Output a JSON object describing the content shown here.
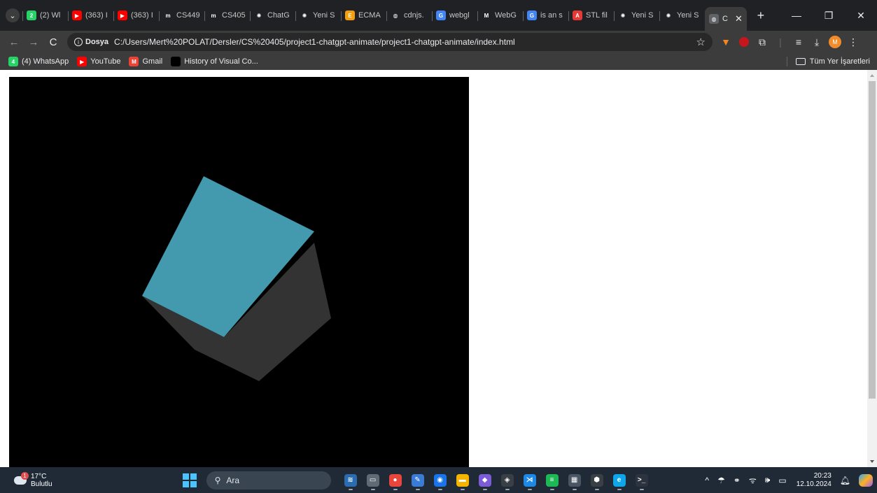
{
  "browser": {
    "tabs": [
      {
        "title": "(2) Wl",
        "icon": "whatsapp-icon",
        "color": "#25d366",
        "glyph": "2"
      },
      {
        "title": "(363) I",
        "icon": "youtube-icon",
        "color": "#ff0000",
        "glyph": "▶"
      },
      {
        "title": "(363) I",
        "icon": "youtube-icon",
        "color": "#ff0000",
        "glyph": "▶"
      },
      {
        "title": "CS449",
        "icon": "moodle-icon",
        "color": "#202124",
        "glyph": "m"
      },
      {
        "title": "CS405",
        "icon": "moodle-icon",
        "color": "#202124",
        "glyph": "m"
      },
      {
        "title": "ChatG",
        "icon": "chatgpt-icon",
        "color": "#202124",
        "glyph": "✺"
      },
      {
        "title": "Yeni S",
        "icon": "chatgpt-icon",
        "color": "#202124",
        "glyph": "✺"
      },
      {
        "title": "ECMA",
        "icon": "ecma-icon",
        "color": "#f59e0b",
        "glyph": "E"
      },
      {
        "title": "cdnjs.",
        "icon": "globe-icon",
        "color": "#202124",
        "glyph": "◍"
      },
      {
        "title": "webgl",
        "icon": "google-icon",
        "color": "#4285f4",
        "glyph": "G"
      },
      {
        "title": "WebG",
        "icon": "mdn-icon",
        "color": "#202124",
        "glyph": "M"
      },
      {
        "title": "is an s",
        "icon": "google-icon",
        "color": "#4285f4",
        "glyph": "G"
      },
      {
        "title": "STL fil",
        "icon": "autodesk-icon",
        "color": "#e53935",
        "glyph": "A"
      },
      {
        "title": "Yeni S",
        "icon": "chatgpt-icon",
        "color": "#202124",
        "glyph": "✺"
      },
      {
        "title": "Yeni S",
        "icon": "chatgpt-icon",
        "color": "#202124",
        "glyph": "✺"
      }
    ],
    "active_tab": {
      "title": "C",
      "icon": "globe-icon"
    },
    "toolbar": {
      "back": "←",
      "forward": "→",
      "reload": "C",
      "site_chip": "Dosya",
      "url": "C:/Users/Mert%20POLAT/Dersler/CS%20405/project1-chatgpt-animate/project1-chatgpt-animate/index.html"
    },
    "bookmarks": [
      {
        "label": "(4) WhatsApp",
        "icon": "whatsapp-icon",
        "color": "#25d366",
        "glyph": "4"
      },
      {
        "label": "YouTube",
        "icon": "youtube-icon",
        "color": "#ff0000",
        "glyph": "▶"
      },
      {
        "label": "Gmail",
        "icon": "gmail-icon",
        "color": "#ea4335",
        "glyph": "M"
      },
      {
        "label": "History of Visual Co...",
        "icon": "black-square-icon",
        "color": "#000000",
        "glyph": ""
      }
    ],
    "all_bookmarks": "Tüm Yer İşaretleri",
    "avatar_letter": "M"
  },
  "scene": {
    "background": "#000000",
    "cube_faces": {
      "top": "#4399ad",
      "side": "#333333"
    }
  },
  "taskbar": {
    "weather": {
      "temp": "17°C",
      "desc": "Bulutlu",
      "badge": "1"
    },
    "search_placeholder": "Ara",
    "apps": [
      {
        "name": "widgets-app",
        "color": "#2b6cb0",
        "glyph": "≋"
      },
      {
        "name": "task-view-app",
        "color": "#606a75",
        "glyph": "▭"
      },
      {
        "name": "chrome-app",
        "color": "#e8453c",
        "glyph": "●"
      },
      {
        "name": "paint-app",
        "color": "#3a7bd5",
        "glyph": "✎"
      },
      {
        "name": "maps-app",
        "color": "#1a73e8",
        "glyph": "◉"
      },
      {
        "name": "file-explorer-app",
        "color": "#f4b400",
        "glyph": "▬"
      },
      {
        "name": "visual-studio-app",
        "color": "#7b5cd6",
        "glyph": "◆"
      },
      {
        "name": "unity-app",
        "color": "#3a3f46",
        "glyph": "◈"
      },
      {
        "name": "vscode-app",
        "color": "#1e88e5",
        "glyph": "⋊"
      },
      {
        "name": "spotify-app",
        "color": "#1db954",
        "glyph": "≡"
      },
      {
        "name": "calculator-app",
        "color": "#4a5563",
        "glyph": "▦"
      },
      {
        "name": "steam-app",
        "color": "#3a3f46",
        "glyph": "⬢"
      },
      {
        "name": "edge-app",
        "color": "#0ea5e9",
        "glyph": "e"
      },
      {
        "name": "terminal-app",
        "color": "#2d3440",
        "glyph": ">_"
      }
    ],
    "tray_icons": [
      "^",
      "☂",
      "⚭",
      "ᯤ",
      "🕪",
      "▭"
    ],
    "time": "20:23",
    "date": "12.10.2024"
  }
}
